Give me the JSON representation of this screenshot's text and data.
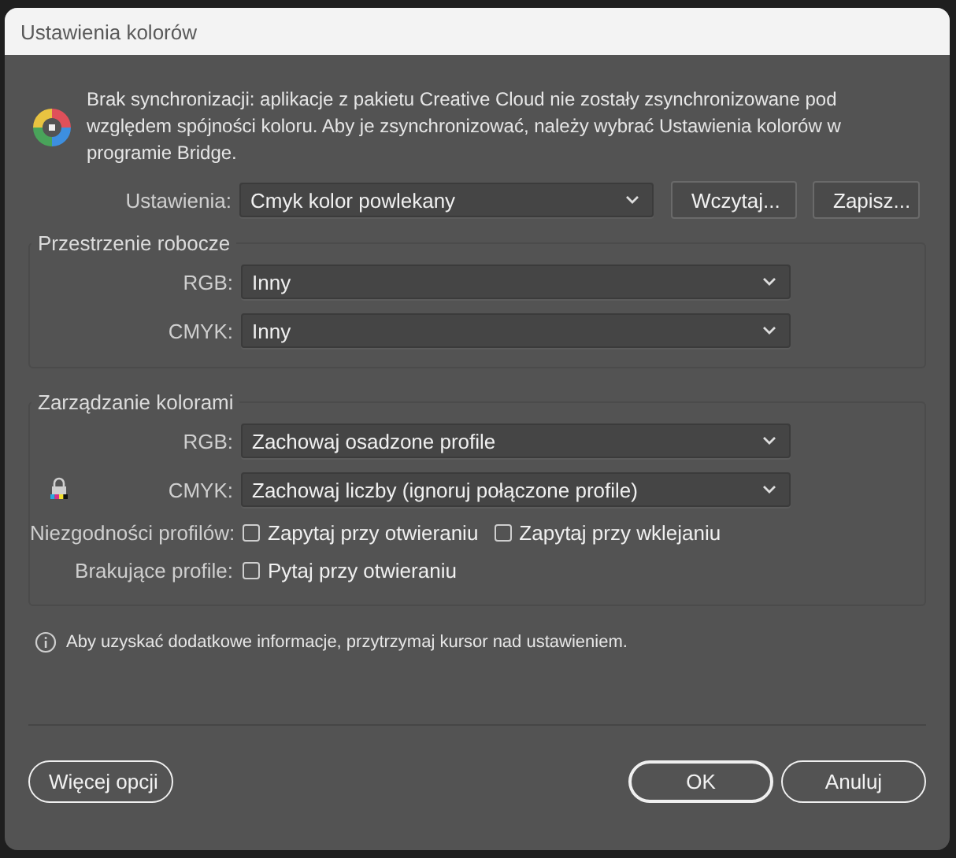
{
  "window": {
    "title": "Ustawienia kolorów"
  },
  "notice": {
    "text": "Brak synchronizacji: aplikacje z pakietu Creative Cloud nie zostały zsynchronizowane pod względem spójności koloru. Aby je zsynchronizować, należy wybrać Ustawienia kolorów w programie Bridge."
  },
  "settings": {
    "label": "Ustawienia:",
    "value": "Cmyk kolor powlekany",
    "buttons": [
      "Wczytaj...",
      "Zapisz..."
    ]
  },
  "groups": [
    {
      "title": "Przestrzenie robocze",
      "rows": [
        {
          "kind": "select",
          "label": "RGB:",
          "value": "Inny",
          "locked": false
        },
        {
          "kind": "select",
          "label": "CMYK:",
          "value": "Inny",
          "locked": false
        }
      ]
    },
    {
      "title": "Zarządzanie kolorami",
      "rows": [
        {
          "kind": "select",
          "label": "RGB:",
          "value": "Zachowaj osadzone profile",
          "locked": false
        },
        {
          "kind": "select",
          "label": "CMYK:",
          "value": "Zachowaj liczby (ignoruj połączone profile)",
          "locked": true
        },
        {
          "kind": "checks",
          "label": "Niezgodności profilów:",
          "options": [
            {
              "label": "Zapytaj przy otwieraniu",
              "checked": false
            },
            {
              "label": "Zapytaj przy wklejaniu",
              "checked": false
            }
          ]
        },
        {
          "kind": "checks",
          "label": "Brakujące profile:",
          "options": [
            {
              "label": "Pytaj przy otwieraniu",
              "checked": false
            }
          ]
        }
      ]
    }
  ],
  "info": "Aby uzyskać dodatkowe informacje, przytrzymaj kursor nad ustawieniem.",
  "buttons": [
    {
      "label": "Więcej opcji",
      "default": false
    },
    {
      "label": "OK",
      "default": true
    },
    {
      "label": "Anuluj",
      "default": false
    }
  ]
}
